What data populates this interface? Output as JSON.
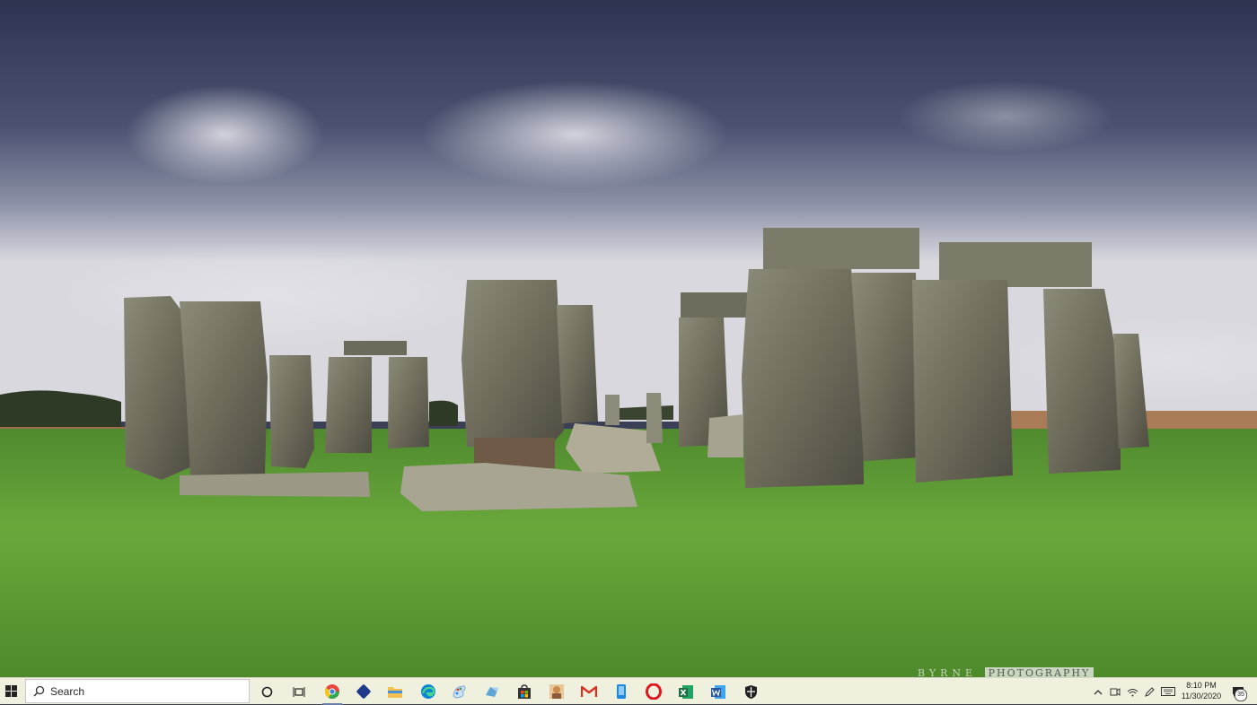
{
  "wallpaper": {
    "description_icon": "stonehenge-wallpaper",
    "watermark_left": "BYRNE",
    "watermark_box": "PHOTOGRAPHY"
  },
  "taskbar": {
    "search": {
      "label": "Search",
      "icon": "search-icon"
    },
    "apps": [
      {
        "icon": "cortana-icon"
      },
      {
        "icon": "task-view-icon"
      },
      {
        "icon": "chrome-icon",
        "color": "#e8453c"
      },
      {
        "icon": "app-blue-icon",
        "color": "#1e3a8a"
      },
      {
        "icon": "file-explorer-icon",
        "color": "#f2c14e"
      },
      {
        "icon": "edge-icon",
        "color": "#0a84d6"
      },
      {
        "icon": "paint-icon",
        "color": "#7aa9d8"
      },
      {
        "icon": "cloud-app-icon",
        "color": "#5fa6d6"
      },
      {
        "icon": "store-icon",
        "color": "#333333"
      },
      {
        "icon": "photo-app-icon",
        "color": "#c98a4a"
      },
      {
        "icon": "gmail-icon",
        "color": "#d93025"
      },
      {
        "icon": "phone-app-icon",
        "color": "#1e88e5"
      },
      {
        "icon": "opera-icon",
        "color": "#e0161e"
      },
      {
        "icon": "excel-icon",
        "color": "#1d6f42"
      },
      {
        "icon": "word-icon",
        "color": "#2b579a"
      },
      {
        "icon": "security-icon",
        "color": "#222222"
      }
    ],
    "tray": {
      "chevron": "^",
      "time": "8:10 PM",
      "date": "11/30/2020",
      "notification_count": "35"
    }
  }
}
